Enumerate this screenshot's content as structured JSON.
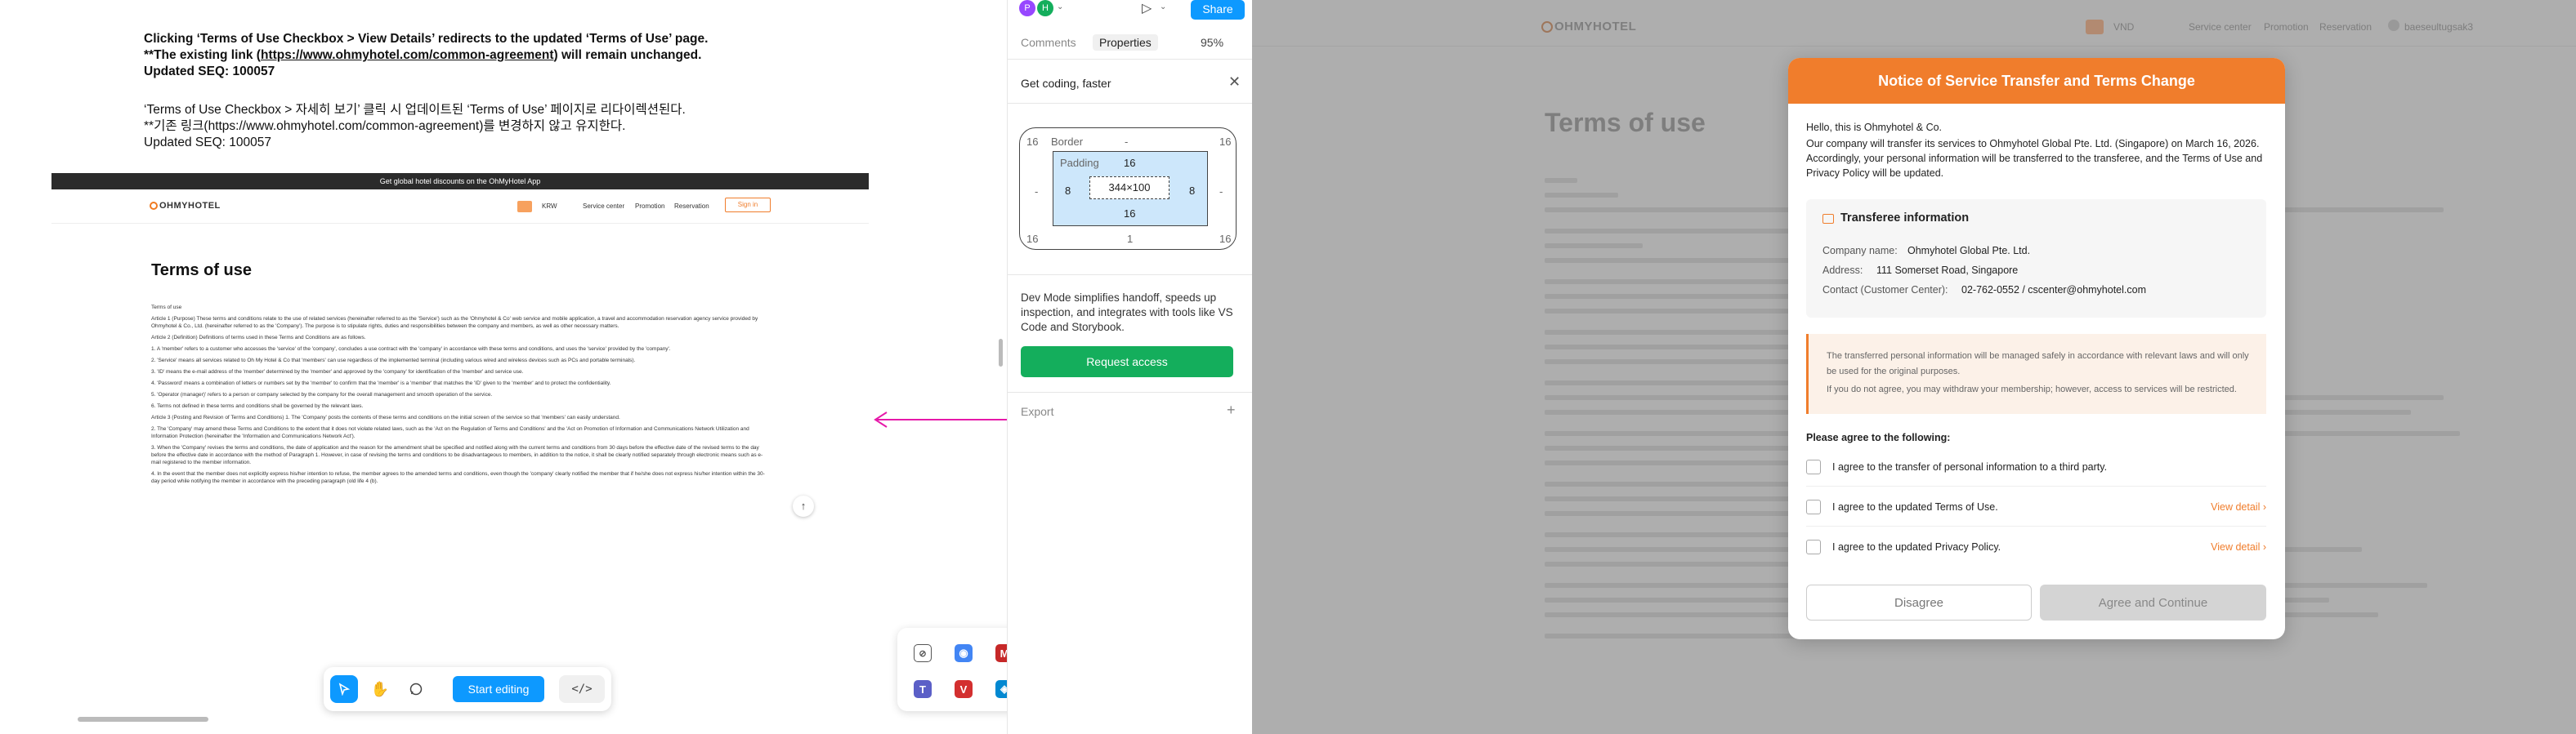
{
  "note": {
    "en_line1": "Clicking ‘Terms of Use Checkbox > View Details’ redirects to the updated ‘Terms of Use’ page.",
    "en_line2_prefix": "**The existing link (",
    "en_line2_link": "https://www.ohmyhotel.com/common-agreement",
    "en_line2_suffix": ") will remain unchanged.",
    "en_line3": "Updated SEQ: 100057",
    "ko_line1": "‘Terms of Use Checkbox > 자세히 보기’ 클릭 시 업데이트된 ‘Terms of Use’ 페이지로 리다이렉션된다.",
    "ko_line2": "**기존 링크(https://www.ohmyhotel.com/common-agreement)를 변경하지 않고 유지한다.",
    "ko_line3": "Updated SEQ: 100057"
  },
  "shot": {
    "promo": "Get global hotel discounts on the OhMyHotel App",
    "logo": "OHMYHOTEL",
    "currency": "KRW",
    "nav": [
      "Service center",
      "Promotion",
      "Reservation"
    ],
    "signin": "Sign in",
    "title": "Terms of use",
    "sub": "Terms of use",
    "paras": [
      "Article 1 (Purpose) These terms and conditions relate to the use of related services (hereinafter referred to as the 'Service') such as the 'Ohmyhotel & Co' web service and mobile application, a travel and accommodation reservation agency service provided by Ohmyhotel & Co., Ltd. (hereinafter referred to as the 'Company'). The purpose is to stipulate rights, duties and responsibilities between the company and members, as well as other necessary matters.",
      "Article 2 (Definition) Definitions of terms used in these Terms and Conditions are as follows.",
      "1. A 'member' refers to a customer who accesses the 'service' of the 'company', concludes a use contract with the 'company' in accordance with these terms and conditions, and uses the 'service' provided by the 'company'.",
      "2. 'Service' means all services related to Oh My Hotel & Co that 'members' can use regardless of the implemented terminal (including various wired and wireless devices such as PCs and portable terminals).",
      "3. 'ID' means the e-mail address of the 'member' determined by the 'member' and approved by the 'company' for identification of the 'member' and service use.",
      "4. 'Password' means a combination of letters or numbers set by the 'member' to confirm that the 'member' is a 'member' that matches the 'ID' given to the 'member' and to protect the confidentiality.",
      "5. 'Operator (manager)' refers to a person or company selected by the company for the overall management and smooth operation of the service.",
      "6. Terms not defined in these terms and conditions shall be governed by the relevant laws.",
      "Article 3 (Posting and Revision of Terms and Conditions) 1. The 'Company' posts the contents of these terms and conditions on the initial screen of the service so that 'members' can easily understand.",
      "2. The 'Company' may amend these Terms and Conditions to the extent that it does not violate related laws, such as the 'Act on the Regulation of Terms and Conditions' and the 'Act on Promotion of Information and Communications Network Utilization and Information Protection (hereinafter the 'Information and Communications Network Act').",
      "3. When the 'Company' revises the terms and conditions, the date of application and the reason for the amendment shall be specified and notified along with the current terms and conditions from 30 days before the effective date of the revised terms to the day before the effective date in accordance with the method of Paragraph 1. However, in case of revising the terms and conditions to be disadvantageous to members, in addition to the notice, it shall be clearly notified separately through electronic means such as e-mail registered to the member information.",
      "4. In the event that the member does not explicitly express his/her intention to refuse, the member agrees to the amended terms and conditions, even though the 'company' clearly notified the member that if he/she does not express his/her intention within the 30-day period while notifying the member in accordance with the preceding paragraph (old life 4 (b)."
    ]
  },
  "toolbar": {
    "start_editing": "Start editing"
  },
  "panel": {
    "avatars": [
      "P",
      "H"
    ],
    "share": "Share",
    "tab_comments": "Comments",
    "tab_properties": "Properties",
    "zoom": "95%",
    "banner": "Get coding, faster",
    "border_label": "Border",
    "border_dash": "-",
    "padding_label": "Padding",
    "m_top": "16",
    "m_left": "16",
    "m_right": "16",
    "m_bl": "16",
    "m_br": "16",
    "m_bottom": "1",
    "side_l": "-",
    "side_r": "-",
    "p_top": "16",
    "p_left": "8",
    "p_right": "8",
    "p_bottom": "16",
    "size": "344×100",
    "devmode": "Dev Mode simplifies handoff, speeds up inspection, and integrates with tools like VS Code and Storybook.",
    "request": "Request access",
    "export": "Export"
  },
  "bg": {
    "logo": "OHMYHOTEL",
    "currency": "VND",
    "nav": [
      "Service center",
      "Promotion",
      "Reservation"
    ],
    "user": "baeseultugsak3",
    "title": "Terms of use"
  },
  "modal": {
    "title": "Notice of Service Transfer and Terms Change",
    "hello": "Hello, this is Ohmyhotel & Co.",
    "intro": "Our company will transfer its services to Ohmyhotel Global Pte. Ltd. (Singapore) on March 16, 2026. Accordingly, your personal information will be transferred to the transferee, and the Terms of Use and Privacy Policy will be updated.",
    "tr_title": "Transferee information",
    "company_label": "Company name:",
    "company": "Ohmyhotel Global Pte. Ltd.",
    "address_label": "Address:",
    "address": "111 Somerset Road, Singapore",
    "contact_label": "Contact (Customer Center):",
    "contact": "02-762-0552 / cscenter@ohmyhotel.com",
    "warn1": "The transferred personal information will be managed safely in accordance with relevant laws and will only be used for the original purposes.",
    "warn2": "If you do not agree, you may withdraw your membership; however, access to services will be restricted.",
    "agree_head": "Please agree to the following:",
    "items": [
      {
        "label": "I agree to the transfer of personal information to a third party.",
        "link": ""
      },
      {
        "label": "I agree to the updated Terms of Use.",
        "link": "View detail"
      },
      {
        "label": "I agree to the updated Privacy Policy.",
        "link": "View detail"
      }
    ],
    "disagree": "Disagree",
    "agree": "Agree and Continue"
  },
  "colors": {
    "accent": "#f07d2c",
    "figma_blue": "#0d99ff",
    "green": "#14ae5c",
    "arrow": "#e619a9"
  }
}
